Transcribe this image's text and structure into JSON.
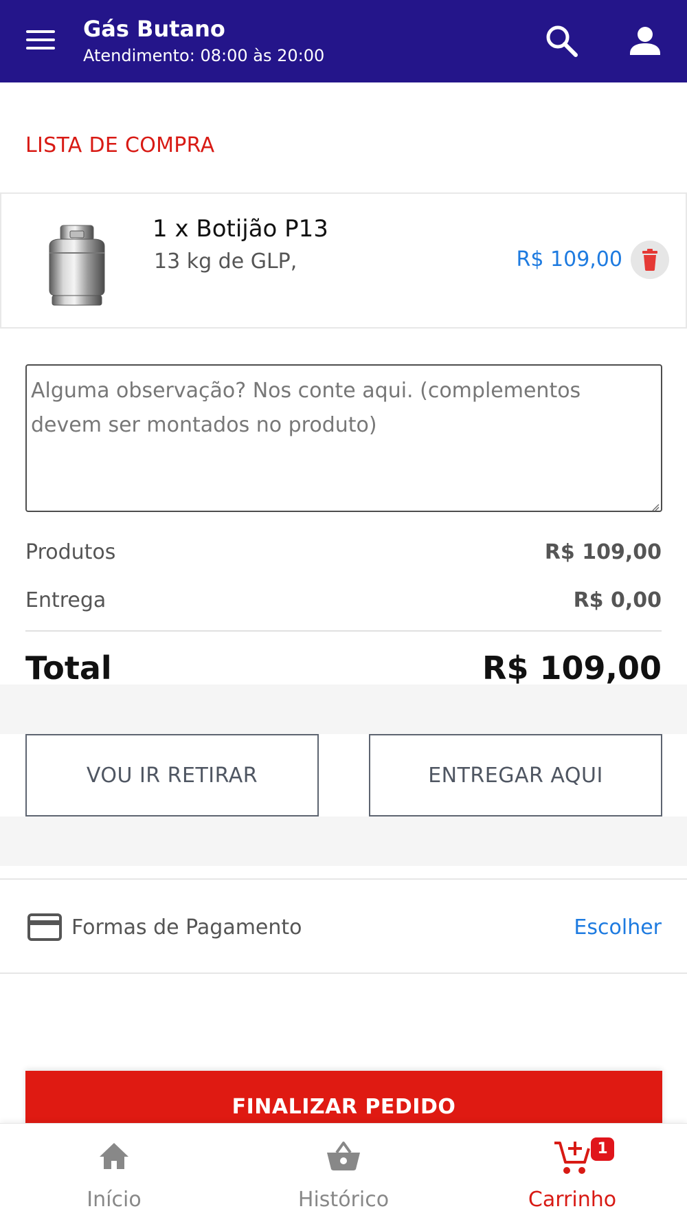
{
  "header": {
    "store_name": "Gás Butano",
    "hours": "Atendimento: 08:00 às 20:00",
    "icons": [
      "menu-icon",
      "search-icon",
      "account-icon"
    ],
    "bg_color": "#24158a"
  },
  "cart": {
    "section_title": "LISTA DE COMPRA",
    "items": [
      {
        "name": "1 x Botijão P13",
        "description": "13 kg de GLP,",
        "price": "R$ 109,00",
        "image_icon": "gas-cylinder-image",
        "delete_icon": "trash-icon"
      }
    ]
  },
  "note": {
    "placeholder": "Alguma observação? Nos conte aqui. (complementos devem ser montados no produto)",
    "value": ""
  },
  "summary": {
    "products_label": "Produtos",
    "products_value": "R$ 109,00",
    "delivery_label": "Entrega",
    "delivery_value": "R$ 0,00",
    "total_label": "Total",
    "total_value": "R$ 109,00"
  },
  "delivery_options": {
    "pickup_label": "VOU IR RETIRAR",
    "deliver_label": "ENTREGAR AQUI"
  },
  "payment": {
    "label": "Formas de Pagamento",
    "action": "Escolher",
    "icon": "credit-card-icon"
  },
  "finalize": {
    "label": "FINALIZAR PEDIDO",
    "color": "#df1a12"
  },
  "bottom_nav": {
    "items": [
      {
        "label": "Início",
        "icon": "home-icon",
        "active": false
      },
      {
        "label": "Histórico",
        "icon": "basket-icon",
        "active": false
      },
      {
        "label": "Carrinho",
        "icon": "cart-add-icon",
        "active": true,
        "badge": "1"
      }
    ]
  },
  "colors": {
    "accent_red": "#d81a14",
    "link_blue": "#1e7be0"
  }
}
